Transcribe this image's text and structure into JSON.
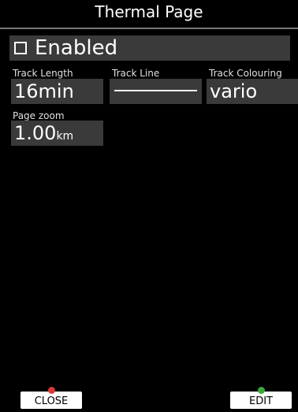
{
  "title": "Thermal Page",
  "enabled": {
    "label": "Enabled",
    "checked": false
  },
  "fields": {
    "track_length": {
      "label": "Track Length",
      "value": "16min"
    },
    "track_line": {
      "label": "Track Line"
    },
    "track_colouring": {
      "label": "Track Colouring",
      "value": "vario"
    },
    "page_zoom": {
      "label": "Page zoom",
      "value": "1.00",
      "unit": "km"
    }
  },
  "footer": {
    "close_label": "CLOSE",
    "edit_label": "EDIT"
  },
  "colors": {
    "background": "#000000",
    "field_bg": "#3a3a3a",
    "close_icon": "#d93a3a",
    "edit_icon": "#38a838"
  }
}
